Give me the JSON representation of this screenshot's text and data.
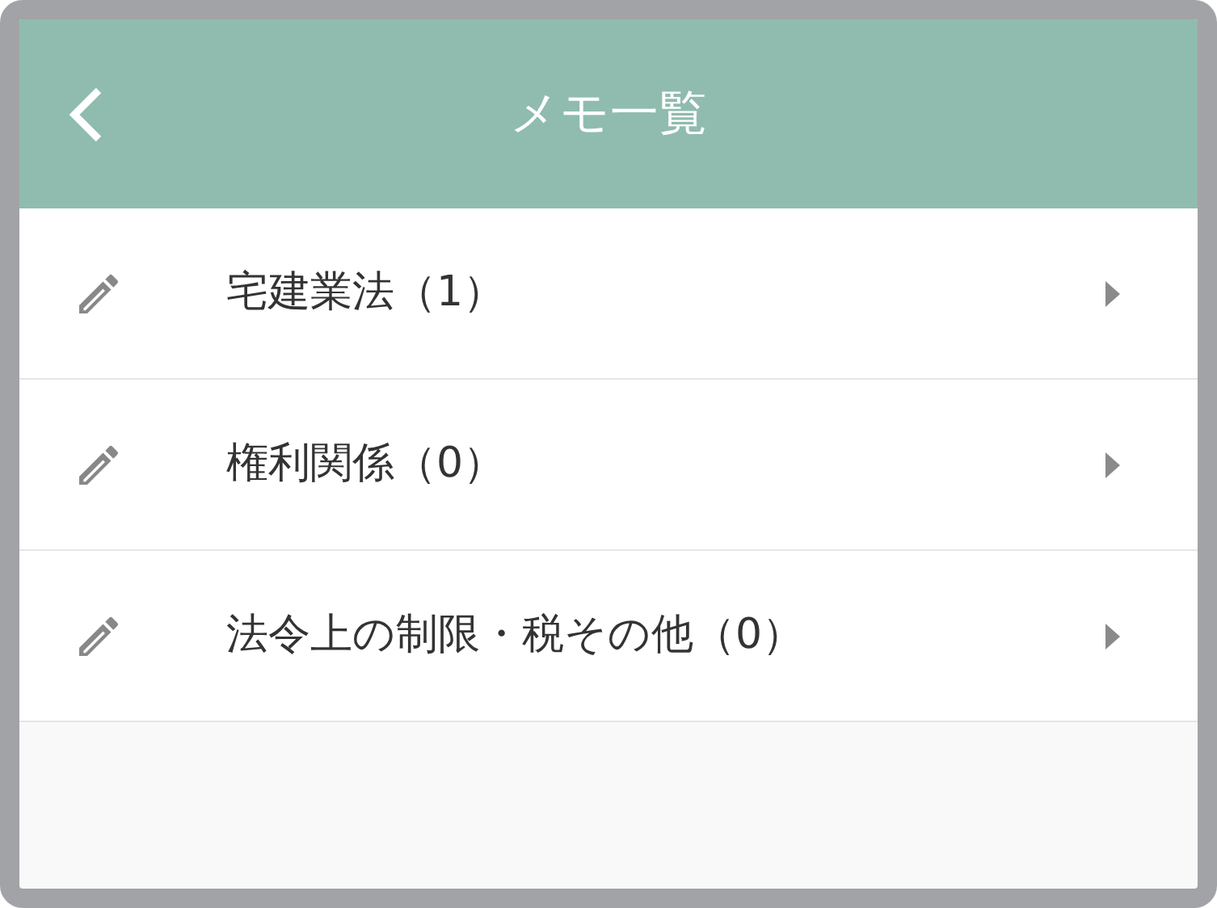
{
  "header": {
    "title": "メモ一覧"
  },
  "memo_categories": [
    {
      "label": "宅建業法（1）"
    },
    {
      "label": "権利関係（0）"
    },
    {
      "label": "法令上の制限・税その他（0）"
    }
  ]
}
